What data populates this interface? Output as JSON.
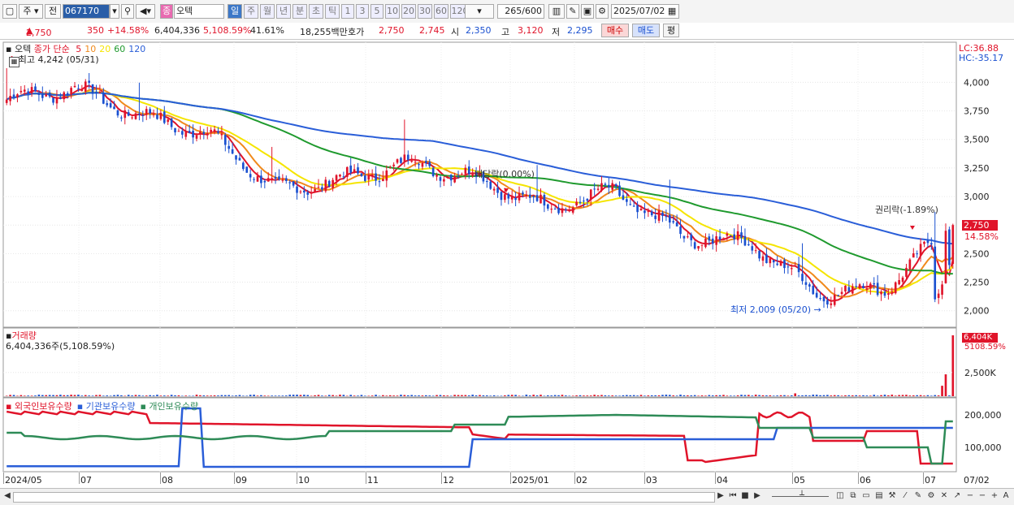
{
  "toolbar": {
    "market": "주",
    "prev": "전",
    "code": "067170",
    "stock_icon": "종",
    "stock_name": "오텍",
    "periods": [
      "일",
      "주",
      "월",
      "년",
      "분",
      "초",
      "틱"
    ],
    "intervals": [
      "1",
      "3",
      "5",
      "10",
      "20",
      "30",
      "60",
      "120"
    ],
    "count": "265",
    "count_total": "/600",
    "date": "2025/07/02"
  },
  "info": {
    "price": "2,750",
    "change": "350",
    "change_pct": "+14.58%",
    "volume": "6,404,336",
    "vol_pct": "5,108.59%",
    "turnover": "41.61%",
    "amount": "18,255백만",
    "hoga_label": "호가",
    "ask": "2,750",
    "bid": "2,745",
    "open_label": "시",
    "open": "2,350",
    "high_label": "고",
    "high": "3,120",
    "low_label": "저",
    "low": "2,295",
    "buy_label": "매수",
    "sell_label": "매도",
    "eval_label": "평"
  },
  "price_panel": {
    "name": "오텍",
    "ma_label": "종가 단순",
    "ma_periods": [
      "5",
      "10",
      "20",
      "60",
      "120"
    ],
    "ma_colors": [
      "#e0142a",
      "#f08a1c",
      "#f5e500",
      "#1f9a2e",
      "#2a5ed8"
    ],
    "high_note": "최고 4,242 (05/31)",
    "low_note": "최저 2,009 (05/20)",
    "dividend_note": "배당락(0.00%)",
    "rights_note": "권리락(-1.89%)",
    "lc": "LC:36.88",
    "hc": "HC:-35.17",
    "last_price": "2,750",
    "last_pct": "14.58%"
  },
  "volume_panel": {
    "title": "거래량",
    "value": "6,404,336주(5,108.59%)",
    "last": "6,404K",
    "last_pct": "5108.59%",
    "tick": "2,500K"
  },
  "holdings_panel": {
    "series": [
      "외국인보유수량",
      "기관보유수량",
      "개인보유수량"
    ],
    "colors": [
      "#e0142a",
      "#2a5ed8",
      "#2e8b57"
    ],
    "ticks": [
      "200,000",
      "100,000"
    ]
  },
  "xaxis": [
    "2024/05",
    "07",
    "08",
    "09",
    "10",
    "11",
    "12",
    "2025/01",
    "02",
    "03",
    "04",
    "05",
    "06",
    "07"
  ],
  "xaxis_right": "07/02",
  "chart_data": {
    "type": "candlestick",
    "y_ticks": [
      4000,
      3750,
      3500,
      3250,
      3000,
      2750,
      2500,
      2250,
      2000
    ],
    "ylim": [
      1870,
      4330
    ],
    "price_series": {
      "months": [
        "2024/05",
        "06",
        "07",
        "08",
        "09",
        "10",
        "11",
        "12",
        "2025/01",
        "02",
        "03",
        "04",
        "05",
        "06",
        "07"
      ],
      "approx_close": [
        3850,
        3950,
        3700,
        3550,
        3050,
        3150,
        3300,
        3150,
        2900,
        3050,
        2650,
        2600,
        2150,
        2200,
        2750
      ]
    },
    "volume_max_k": 6404,
    "holdings_ylim": [
      20000,
      230000
    ]
  }
}
